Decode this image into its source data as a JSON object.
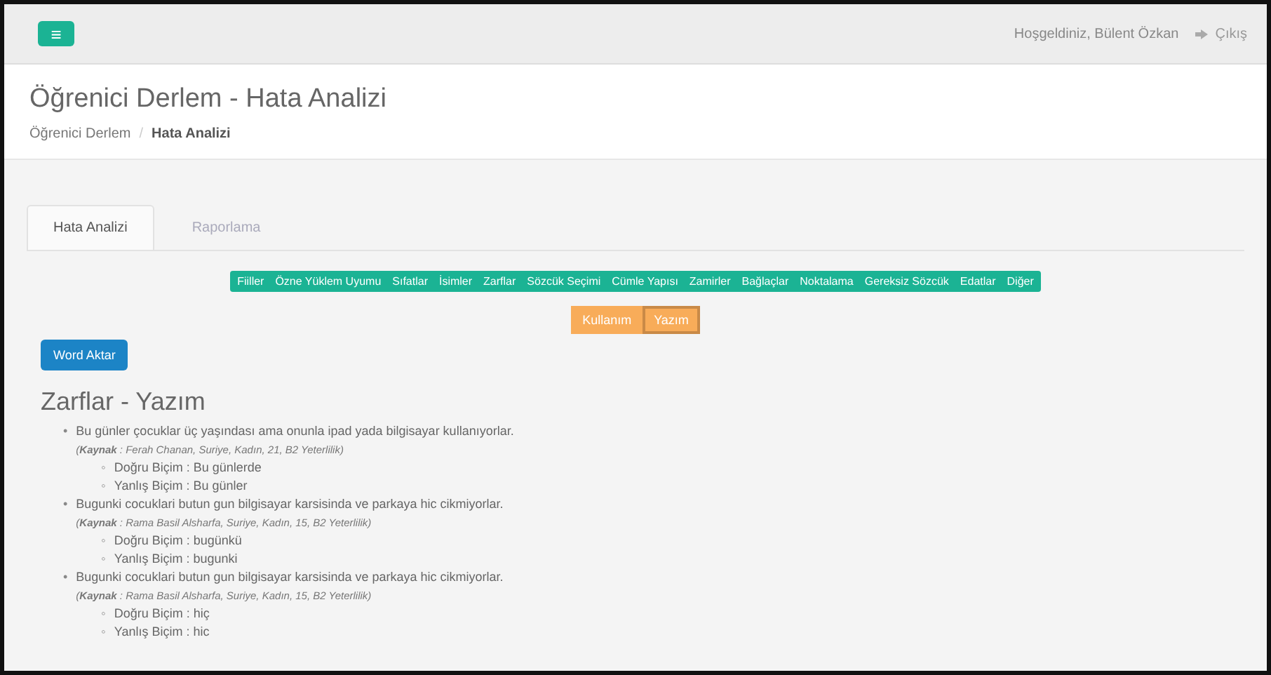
{
  "topbar": {
    "menu_icon": "≡",
    "welcome": "Hoşgeldiniz, Bülent Özkan",
    "logout": "Çıkış"
  },
  "page_header": {
    "title": "Öğrenici Derlem - Hata Analizi",
    "separator": "/",
    "breadcrumb": [
      {
        "label": "Öğrenici Derlem",
        "current": false
      },
      {
        "label": "Hata Analizi",
        "current": true
      }
    ]
  },
  "tabs": [
    {
      "label": "Hata Analizi",
      "selected": true
    },
    {
      "label": "Raporlama",
      "selected": false
    }
  ],
  "categories": [
    "Fiiller",
    "Özne Yüklem Uyumu",
    "Sıfatlar",
    "İsimler",
    "Zarflar",
    "Sözcük Seçimi",
    "Cümle Yapısı",
    "Zamirler",
    "Bağlaçlar",
    "Noktalama",
    "Gereksiz Sözcük",
    "Edatlar",
    "Diğer"
  ],
  "subtypes": [
    {
      "label": "Kullanım",
      "selected": false
    },
    {
      "label": "Yazım",
      "selected": true
    }
  ],
  "export_button": "Word Aktar",
  "section_title": "Zarflar - Yazım",
  "bullet": "•",
  "sub_bullet": "◦",
  "entries": [
    {
      "sentence": "Bu günler çocuklar üç yaşındası ama onunla ipad yada bilgisayar kullanıyorlar.",
      "source": "(**Kaynak** : Ferah Chanan, Suriye, Kadın, 21, B2 Yeterlilik)",
      "correct": "Doğru Biçim : Bu günlerde",
      "wrong": "Yanlış Biçim : Bu günler"
    },
    {
      "sentence": "Bugunki cocuklari butun gun bilgisayar karsisinda ve parkaya hic cikmiyorlar.",
      "source": "(**Kaynak** : Rama Basil Alsharfa, Suriye, Kadın, 15, B2 Yeterlilik)",
      "correct": "Doğru Biçim : bugünkü",
      "wrong": "Yanlış Biçim : bugunki"
    },
    {
      "sentence": "Bugunki cocuklari butun gun bilgisayar karsisinda ve parkaya hic cikmiyorlar.",
      "source": "(**Kaynak** : Rama Basil Alsharfa, Suriye, Kadın, 15, B2 Yeterlilik)",
      "correct": "Doğru Biçim : hiç",
      "wrong": "Yanlış Biçim : hic"
    }
  ]
}
